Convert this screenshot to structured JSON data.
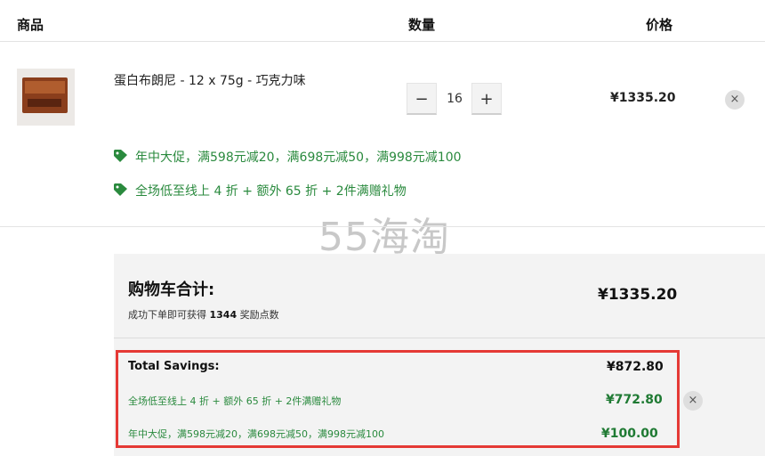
{
  "header": {
    "product": "商品",
    "quantity": "数量",
    "price": "价格"
  },
  "item": {
    "name": "蛋白布朗尼 - 12 x 75g - 巧克力味",
    "quantity": "16",
    "minus": "−",
    "plus": "+",
    "price": "¥1335.20",
    "remove": "×"
  },
  "promos": [
    "年中大促，满598元减20，满698元减50，满998元减100",
    "全场低至线上 4 折 + 额外 65 折 + 2件满赠礼物"
  ],
  "watermark": "55海淘",
  "summary": {
    "title": "购物车合计:",
    "total": "¥1335.20",
    "reward_prefix": "成功下单即可获得 ",
    "reward_points": "1344",
    "reward_suffix": " 奖励点数"
  },
  "savings": {
    "label": "Total Savings:",
    "total": "¥872.80",
    "lines": [
      {
        "text": "全场低至线上 4 折 + 额外 65 折 + 2件满赠礼物",
        "amount": "¥772.80"
      },
      {
        "text": "年中大促，满598元减20，满698元减50，满998元减100",
        "amount": "¥100.00"
      }
    ],
    "remove": "×"
  },
  "colors": {
    "promo_green": "#2a8a3e",
    "highlight_red": "#e53935"
  },
  "icons": {
    "promo": "tag-icon",
    "remove": "close-icon"
  }
}
